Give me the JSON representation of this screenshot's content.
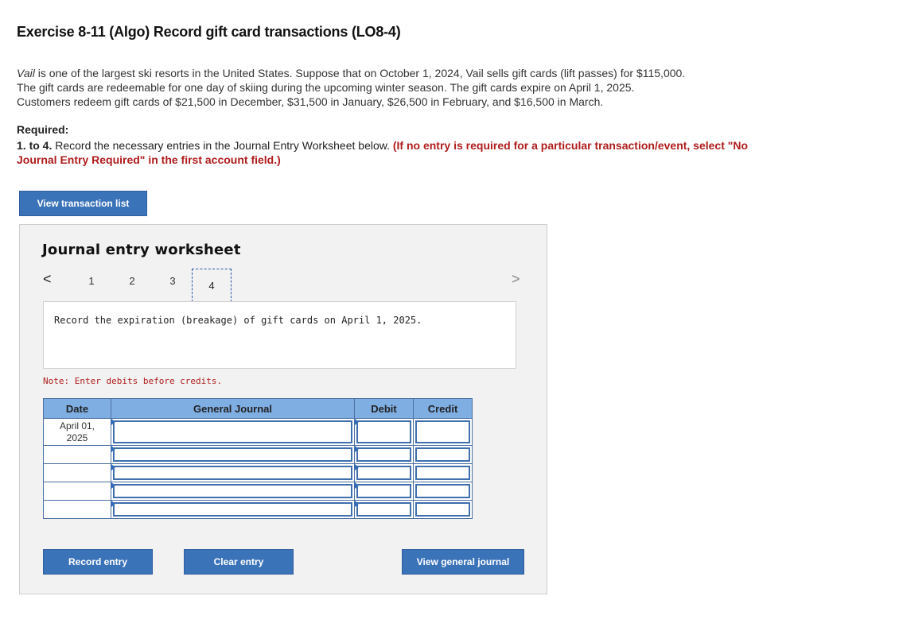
{
  "title": "Exercise 8-11 (Algo) Record gift card transactions (LO8-4)",
  "intro": {
    "company": "Vail",
    "line1_rest": " is one of the largest ski resorts in the United States. Suppose that on October 1, 2024, Vail sells gift cards (lift passes) for $115,000.",
    "line2": "The gift cards are redeemable for one day of skiing during the upcoming winter season. The gift cards expire on April 1, 2025.",
    "line3": "Customers redeem gift cards of $21,500 in December, $31,500 in January, $26,500 in February, and $16,500 in March."
  },
  "required": {
    "heading": "Required:",
    "number": "1. to 4.",
    "text": " Record the necessary entries in the Journal Entry Worksheet below. ",
    "red_note": "(If no entry is required for a particular transaction/event, select \"No Journal Entry Required\" in the first account field.)"
  },
  "buttons": {
    "view_transaction_list": "View transaction list",
    "record_entry": "Record entry",
    "clear_entry": "Clear entry",
    "view_general_journal": "View general journal"
  },
  "worksheet": {
    "title": "Journal entry worksheet",
    "nav_prev": "<",
    "nav_next": ">",
    "pages": [
      "1",
      "2",
      "3",
      "4"
    ],
    "active_page": "4",
    "prompt": "Record the expiration (breakage) of gift cards on April 1, 2025.",
    "note": "Note: Enter debits before credits."
  },
  "journal": {
    "headers": {
      "date": "Date",
      "account": "General Journal",
      "debit": "Debit",
      "credit": "Credit"
    },
    "rows": [
      {
        "date": "April 01,\n2025",
        "account": "",
        "debit": "",
        "credit": ""
      },
      {
        "date": "",
        "account": "",
        "debit": "",
        "credit": ""
      },
      {
        "date": "",
        "account": "",
        "debit": "",
        "credit": ""
      },
      {
        "date": "",
        "account": "",
        "debit": "",
        "credit": ""
      },
      {
        "date": "",
        "account": "",
        "debit": "",
        "credit": ""
      }
    ]
  }
}
